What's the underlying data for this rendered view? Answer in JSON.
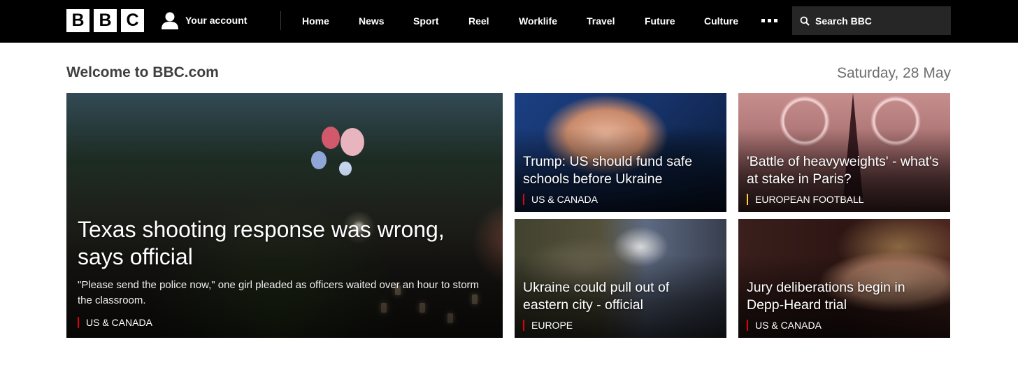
{
  "header": {
    "logo_letters": [
      "B",
      "B",
      "C"
    ],
    "account_label": "Your account",
    "nav": [
      {
        "label": "Home"
      },
      {
        "label": "News"
      },
      {
        "label": "Sport"
      },
      {
        "label": "Reel"
      },
      {
        "label": "Worklife"
      },
      {
        "label": "Travel"
      },
      {
        "label": "Future"
      },
      {
        "label": "Culture"
      }
    ],
    "more_icon": "ellipsis-icon",
    "search_placeholder": "Search BBC"
  },
  "welcome": {
    "title": "Welcome to BBC.com",
    "date": "Saturday, 28 May"
  },
  "stories": {
    "main": {
      "headline": "Texas shooting response was wrong, says official",
      "summary": "\"Please send the police now,\" one girl pleaded as officers waited over an hour to storm the classroom.",
      "tag": "US & CANADA"
    },
    "top_mid": {
      "headline": "Trump: US should fund safe schools before Ukraine",
      "tag": "US & CANADA"
    },
    "top_right": {
      "headline": "'Battle of heavyweights' - what's at stake in Paris?",
      "tag": "EUROPEAN FOOTBALL"
    },
    "bottom_mid": {
      "headline": "Ukraine could pull out of eastern city - official",
      "tag": "EUROPE"
    },
    "bottom_right": {
      "headline": "Jury deliberations begin in Depp-Heard trial",
      "tag": "US & CANADA"
    }
  },
  "colors": {
    "header_bg": "#000000",
    "tag_red": "#e3000b",
    "tag_yellow": "#ffd230"
  }
}
